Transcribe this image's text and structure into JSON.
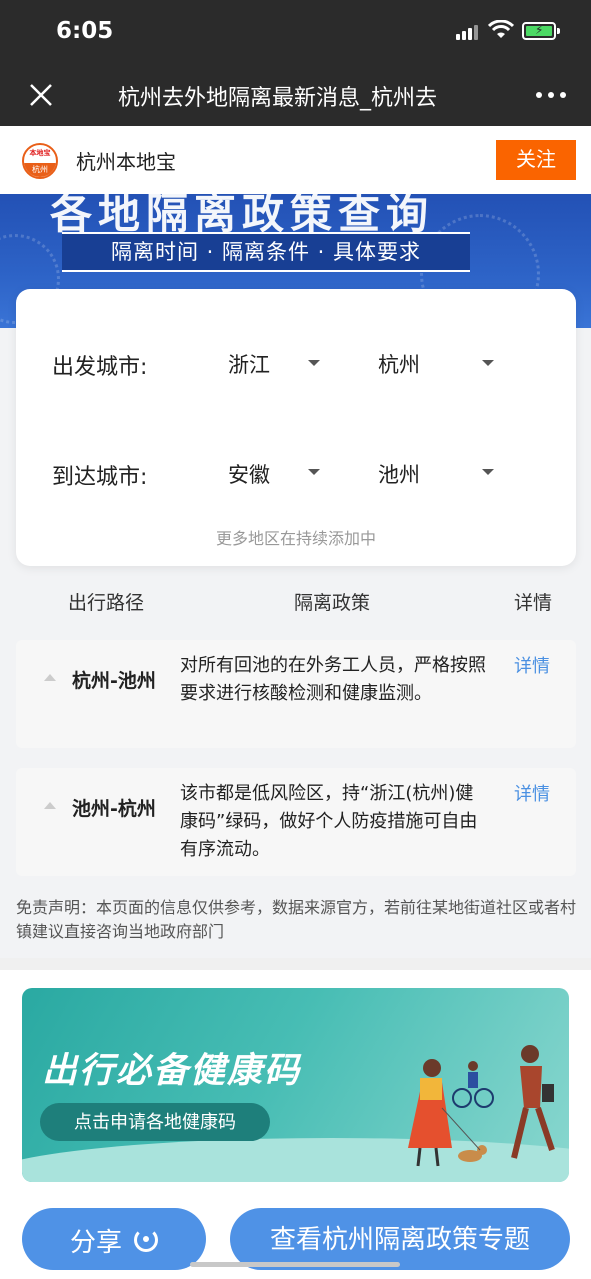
{
  "status_bar": {
    "time": "6:05"
  },
  "nav": {
    "title": "杭州去外地隔离最新消息_杭州去",
    "close_icon": "close-icon",
    "more_icon": "more-icon"
  },
  "account": {
    "logo_top_text": "本地宝",
    "logo_bottom_text": "杭州",
    "name": "杭州本地宝",
    "follow_label": "关注"
  },
  "banner": {
    "heading": "各地隔离政策查询",
    "subtitle": "隔离时间 · 隔离条件 · 具体要求"
  },
  "selector": {
    "departure_label": "出发城市:",
    "departure_province": "浙江",
    "departure_city": "杭州",
    "arrival_label": "到达城市:",
    "arrival_province": "安徽",
    "arrival_city": "池州",
    "hint": "更多地区在持续添加中"
  },
  "table": {
    "headers": [
      "出行路径",
      "隔离政策",
      "详情"
    ],
    "rows": [
      {
        "route": "杭州-池州",
        "policy": "对所有回池的在外务工人员，严格按照要求进行核酸检测和健康监测。",
        "detail": "详情"
      },
      {
        "route": "池州-杭州",
        "policy": "该市都是低风险区，持“浙江(杭州)健康码”绿码，做好个人防疫措施可自由有序流动。",
        "detail": "详情"
      }
    ]
  },
  "disclaimer": "免责声明：本页面的信息仅供参考，数据来源官方，若前往某地街道社区或者村镇建议直接咨询当地政府部门",
  "ad": {
    "title": "出行必备健康码",
    "cta": "点击申请各地健康码"
  },
  "bottom": {
    "share_label": "分享",
    "topic_label": "查看杭州隔离政策专题"
  },
  "colors": {
    "accent": "#fa6400",
    "link": "#4a90e2",
    "button": "#4f92e6"
  }
}
